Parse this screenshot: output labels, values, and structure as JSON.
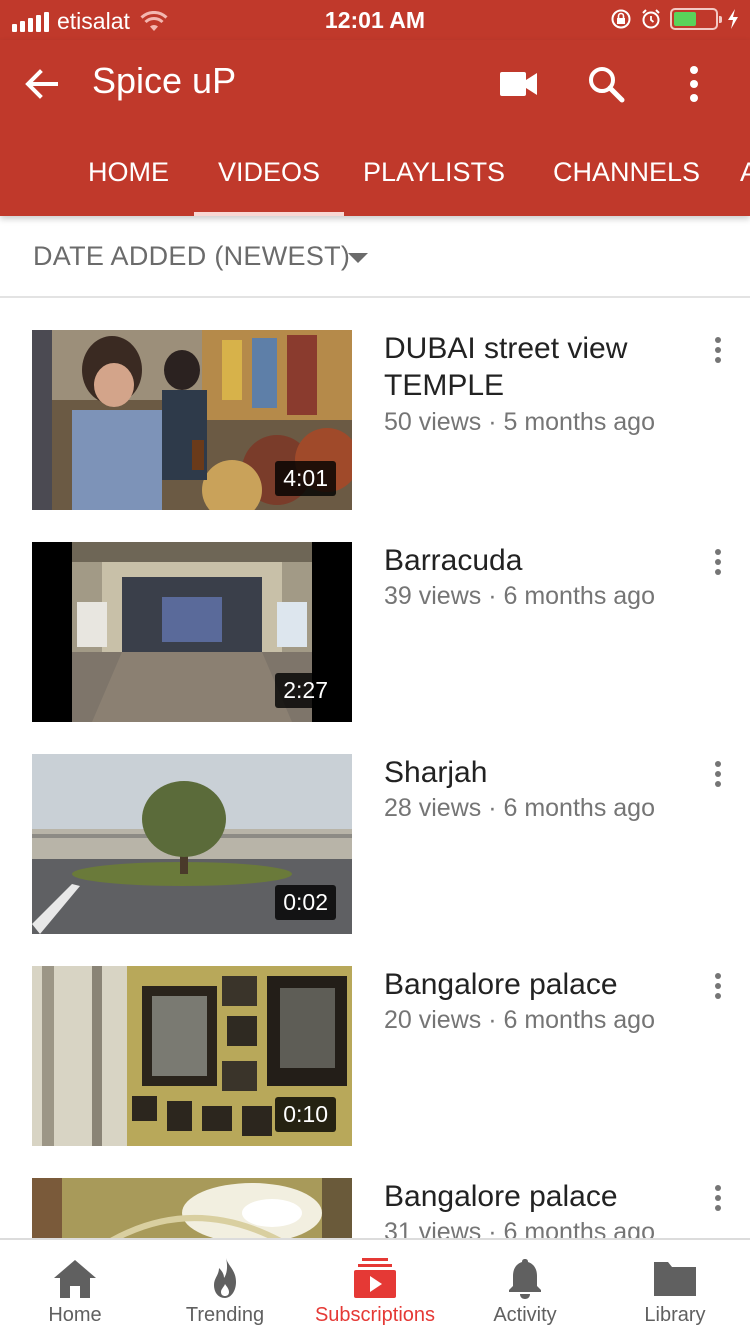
{
  "status_bar": {
    "carrier": "etisalat",
    "time": "12:01 AM",
    "battery_level": 0.55
  },
  "app_bar": {
    "title": "Spice uP",
    "icons": [
      "back-arrow-icon",
      "video-camera-icon",
      "search-icon",
      "more-vertical-icon"
    ]
  },
  "tabs": [
    {
      "label": "HOME",
      "active": false
    },
    {
      "label": "VIDEOS",
      "active": true
    },
    {
      "label": "PLAYLISTS",
      "active": false
    },
    {
      "label": "CHANNELS",
      "active": false
    },
    {
      "label": "A",
      "active": false
    }
  ],
  "sort": {
    "label": "DATE ADDED (NEWEST)"
  },
  "videos": [
    {
      "title": "DUBAI  street view TEMPLE",
      "views": "50 views",
      "age": "5 months ago",
      "meta": "50 views · 5 months ago",
      "duration": "4:01"
    },
    {
      "title": "Barracuda",
      "views": "39 views",
      "age": "6 months ago",
      "meta": "39 views · 6 months ago",
      "duration": "2:27"
    },
    {
      "title": "Sharjah",
      "views": "28 views",
      "age": "6 months ago",
      "meta": "28 views · 6 months ago",
      "duration": "0:02"
    },
    {
      "title": "Bangalore palace",
      "views": "20 views",
      "age": "6 months ago",
      "meta": "20 views · 6 months ago",
      "duration": "0:10"
    },
    {
      "title": "Bangalore palace",
      "views": "31 views",
      "age": "6 months ago",
      "meta": "31 views · 6 months ago",
      "duration": ""
    }
  ],
  "bottom_nav": [
    {
      "label": "Home",
      "icon": "home-icon",
      "active": false
    },
    {
      "label": "Trending",
      "icon": "flame-icon",
      "active": false
    },
    {
      "label": "Subscriptions",
      "icon": "subscriptions-icon",
      "active": true
    },
    {
      "label": "Activity",
      "icon": "bell-icon",
      "active": false
    },
    {
      "label": "Library",
      "icon": "folder-icon",
      "active": false
    }
  ],
  "colors": {
    "brand": "#c0392b",
    "active_nav": "#e53935",
    "battery": "#5ad35a"
  }
}
